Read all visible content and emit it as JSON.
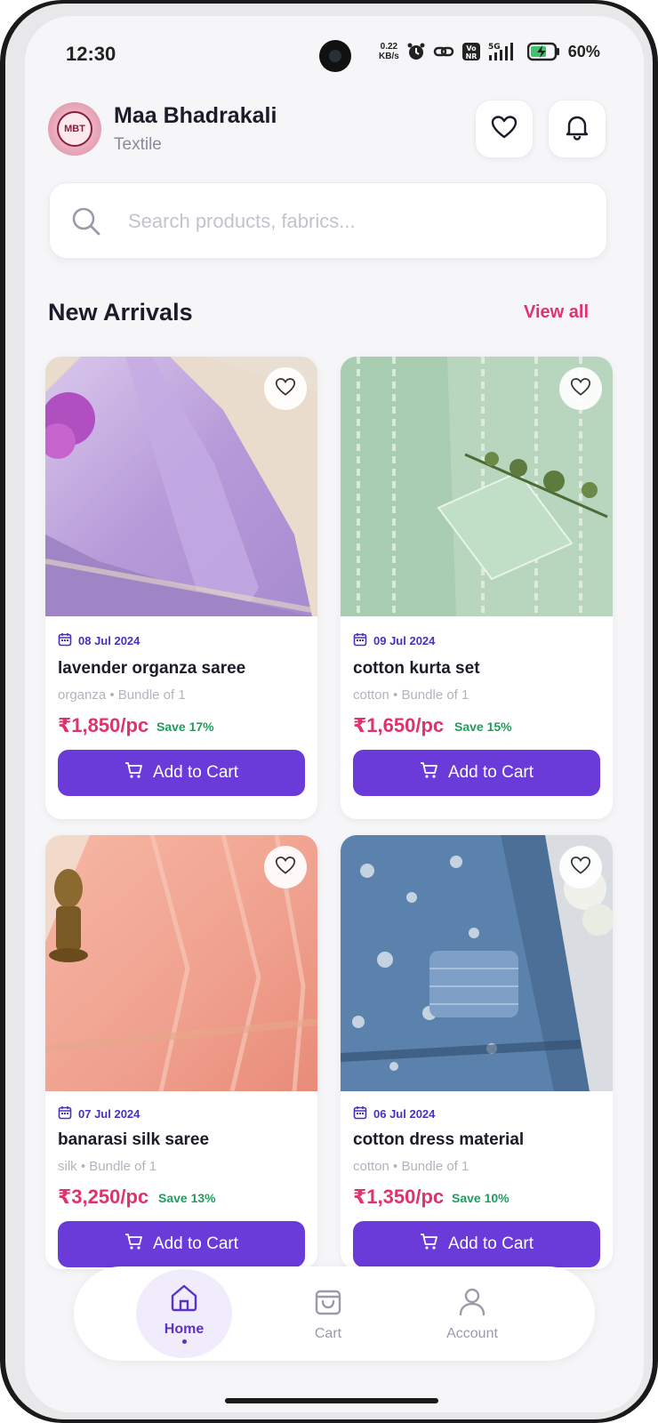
{
  "status_bar": {
    "time": "12:30",
    "net_speed_value": "0.22",
    "net_speed_unit": "KB/s",
    "network_badge": "Vo\nNR",
    "signal_label": "5G",
    "battery_percent": "60%"
  },
  "header": {
    "logo_text": "MBT",
    "store_name": "Maa Bhadrakali",
    "store_subtitle": "Textile"
  },
  "search": {
    "placeholder": "Search products, fabrics..."
  },
  "section": {
    "title": "New Arrivals",
    "view_all_label": "View all"
  },
  "products": [
    {
      "date": "08 Jul 2024",
      "name": "lavender organza saree",
      "meta": "organza • Bundle of 1",
      "price": "₹1,850/pc",
      "save": "Save 17%",
      "add_label": "Add to Cart"
    },
    {
      "date": "09 Jul 2024",
      "name": "cotton kurta set",
      "meta": "cotton • Bundle of 1",
      "price": "₹1,650/pc",
      "save": "Save 15%",
      "add_label": "Add to Cart"
    },
    {
      "date": "07 Jul 2024",
      "name": "banarasi silk saree",
      "meta": "silk • Bundle of 1",
      "price": "₹3,250/pc",
      "save": "Save 13%",
      "add_label": "Add to Cart"
    },
    {
      "date": "06 Jul 2024",
      "name": "cotton dress material",
      "meta": "cotton • Bundle of 1",
      "price": "₹1,350/pc",
      "save": "Save 10%",
      "add_label": "Add to Cart"
    }
  ],
  "bottom_nav": {
    "items": [
      {
        "label": "Home",
        "icon": "home-icon",
        "active": true
      },
      {
        "label": "Cart",
        "icon": "shopping-bag-icon",
        "active": false
      },
      {
        "label": "Account",
        "icon": "user-icon",
        "active": false
      }
    ]
  },
  "colors": {
    "accent": "#6a3bd8",
    "price": "#e0336e",
    "save": "#1e9e5c",
    "link": "#e0336e"
  }
}
